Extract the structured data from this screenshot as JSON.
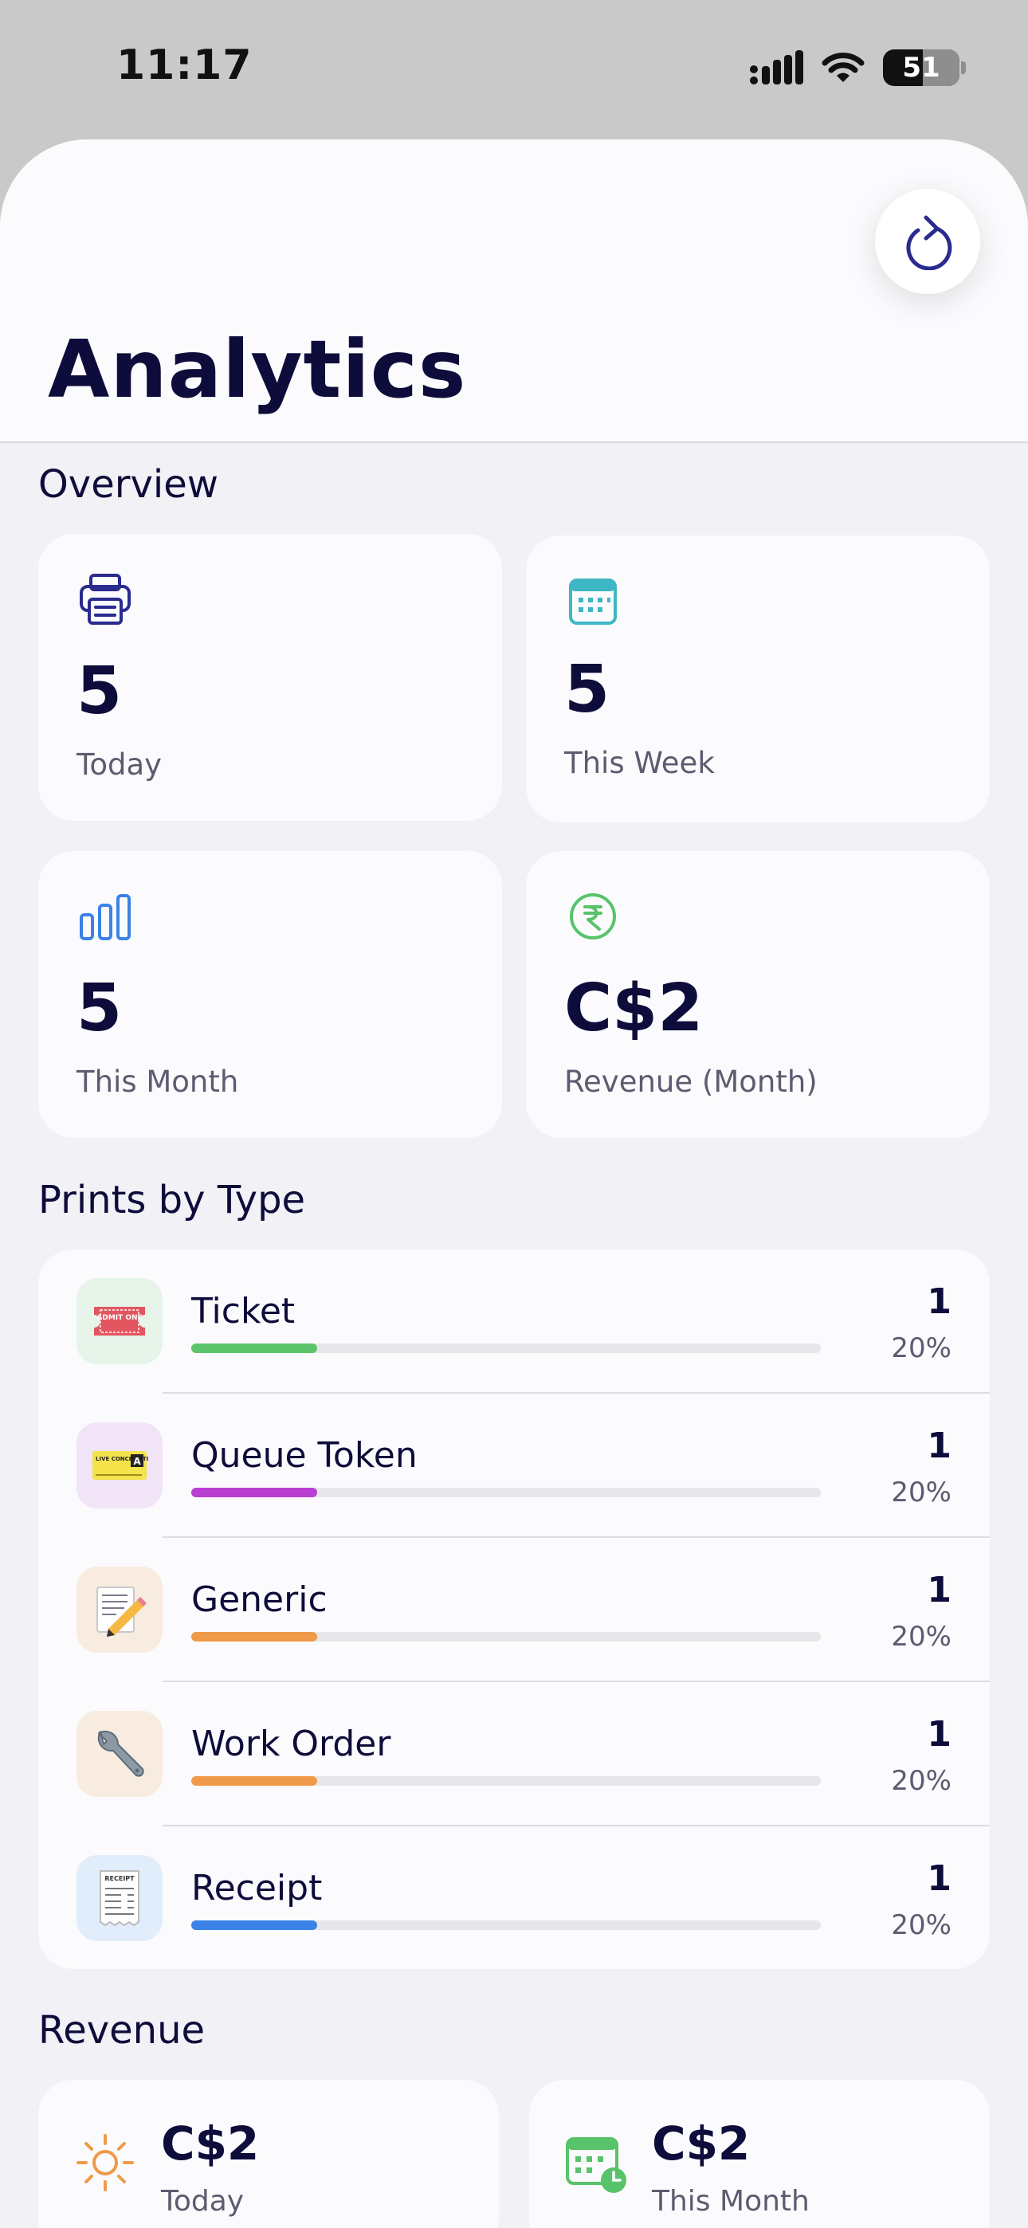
{
  "status_bar": {
    "time": "11:17",
    "battery": "51"
  },
  "header": {
    "title": "Analytics"
  },
  "overview": {
    "title": "Overview",
    "cards": [
      {
        "value": "5",
        "label": "Today",
        "icon": "printer-icon",
        "color": "#2a2a8f"
      },
      {
        "value": "5",
        "label": "This Week",
        "icon": "calendar-icon",
        "color": "#3fb6c4"
      },
      {
        "value": "5",
        "label": "This Month",
        "icon": "bar-chart-icon",
        "color": "#3b82e6"
      },
      {
        "value": "C$2",
        "label": "Revenue (Month)",
        "icon": "rupee-icon",
        "color": "#58c36a"
      }
    ]
  },
  "prints_by_type": {
    "title": "Prints by Type",
    "items": [
      {
        "label": "Ticket",
        "count": "1",
        "percent": "20%",
        "fraction": 0.2,
        "color": "#5cc46a",
        "icon_bg": "#e6f4ea",
        "icon": "admit-one-ticket-icon"
      },
      {
        "label": "Queue Token",
        "count": "1",
        "percent": "20%",
        "fraction": 0.2,
        "color": "#b93fd1",
        "icon_bg": "#f1e4f6",
        "icon": "concert-ticket-icon"
      },
      {
        "label": "Generic",
        "count": "1",
        "percent": "20%",
        "fraction": 0.2,
        "color": "#ef9a48",
        "icon_bg": "#f8ece0",
        "icon": "memo-pencil-icon"
      },
      {
        "label": "Work Order",
        "count": "1",
        "percent": "20%",
        "fraction": 0.2,
        "color": "#ef9a48",
        "icon_bg": "#f8ece0",
        "icon": "wrench-icon"
      },
      {
        "label": "Receipt",
        "count": "1",
        "percent": "20%",
        "fraction": 0.2,
        "color": "#3b82e6",
        "icon_bg": "#e1edfa",
        "icon": "receipt-icon"
      }
    ],
    "icon_text": {
      "ticket": "ADMIT ONE",
      "queue": "LIVE CONCERT TICKET",
      "queue_letter": "A",
      "receipt": "RECEIPT"
    }
  },
  "revenue": {
    "title": "Revenue",
    "cards": [
      {
        "value": "C$2",
        "label": "Today",
        "icon": "sun-icon",
        "color": "#ef9a48"
      },
      {
        "value": "C$2",
        "label": "This Month",
        "icon": "calendar-clock-icon",
        "color": "#58c36a"
      }
    ]
  }
}
